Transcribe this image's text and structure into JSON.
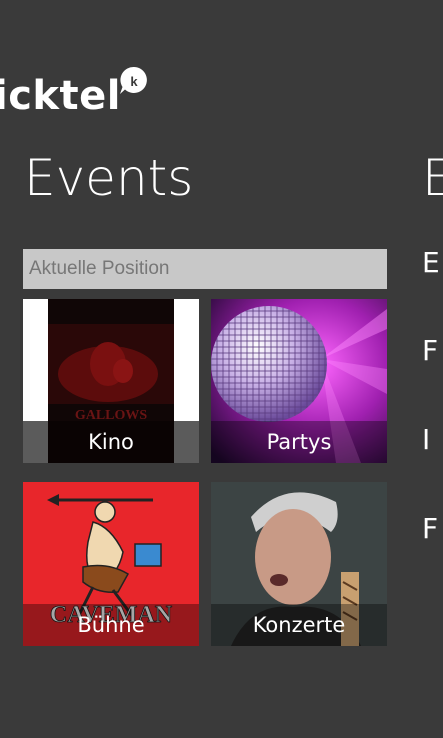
{
  "app": {
    "logo_text": "icktel",
    "logo_badge": "k"
  },
  "main": {
    "title": "Events"
  },
  "search": {
    "placeholder": "Aktuelle Position"
  },
  "tiles": [
    {
      "label": "Kino",
      "poster_text": "GALLOWS"
    },
    {
      "label": "Partys"
    },
    {
      "label": "Bühne",
      "poster_text": "CAVEMAN"
    },
    {
      "label": "Konzerte"
    }
  ],
  "next_panel": {
    "title": "E",
    "items": [
      "E",
      "F",
      "I",
      "F"
    ]
  },
  "colors": {
    "background": "#3a3a3a",
    "search_bg": "#c8c8c8",
    "caveman_red": "#e8262b"
  }
}
